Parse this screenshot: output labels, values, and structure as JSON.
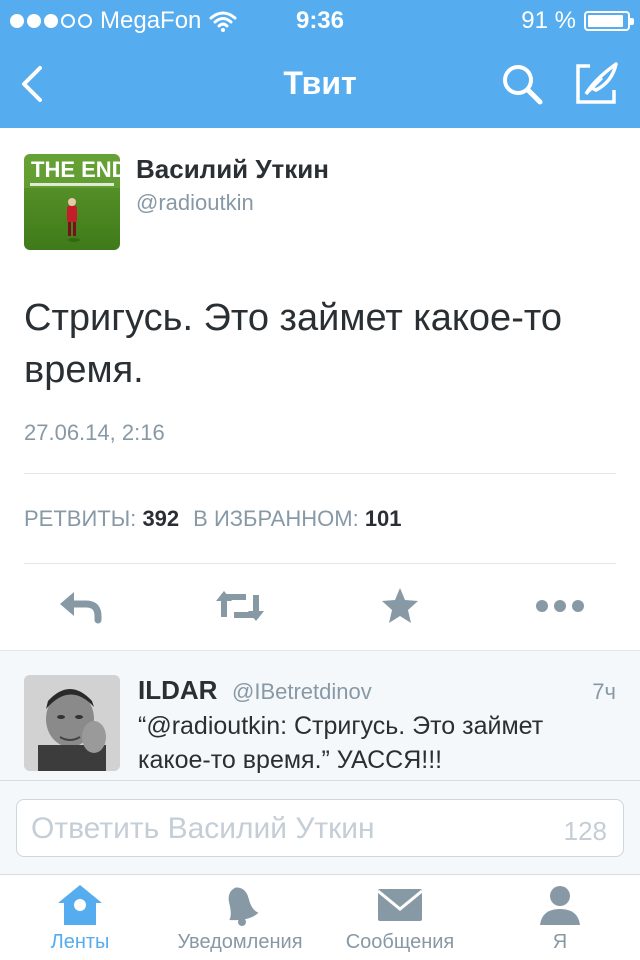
{
  "status_bar": {
    "carrier": "MegaFon",
    "time": "9:36",
    "battery_percent": "91 %",
    "battery_level": 0.91,
    "signal_bars_filled": 3,
    "signal_bars_total": 5
  },
  "nav": {
    "title": "Твит",
    "back_icon": "chevron-left-icon",
    "search_icon": "search-icon",
    "compose_icon": "compose-icon"
  },
  "tweet": {
    "author_name": "Василий Уткин",
    "author_handle": "@radioutkin",
    "avatar_text": "THE END",
    "text": "Стригусь. Это займет какое-то время.",
    "timestamp": "27.06.14, 2:16",
    "retweets_label": "РЕТВИТЫ:",
    "retweets_count": "392",
    "favorites_label": "В ИЗБРАННОМ:",
    "favorites_count": "101"
  },
  "actions": [
    {
      "name": "reply",
      "icon": "reply-icon"
    },
    {
      "name": "retweet",
      "icon": "retweet-icon"
    },
    {
      "name": "favorite",
      "icon": "star-icon"
    },
    {
      "name": "more",
      "icon": "more-icon"
    }
  ],
  "reply": {
    "name": "ILDAR",
    "handle": "@IBetretdinov",
    "time": "7ч",
    "text": "“@radioutkin: Стригусь. Это займет какое-то время.” УАССЯ!!!"
  },
  "compose": {
    "placeholder": "Ответить Василий Уткин",
    "char_count": "128"
  },
  "tabs": [
    {
      "label": "Ленты",
      "icon": "home-icon",
      "active": true
    },
    {
      "label": "Уведомления",
      "icon": "bell-icon",
      "active": false
    },
    {
      "label": "Сообщения",
      "icon": "envelope-icon",
      "active": false
    },
    {
      "label": "Я",
      "icon": "person-icon",
      "active": false
    }
  ],
  "colors": {
    "brand": "#55acee",
    "text": "#292f33",
    "muted": "#8899a6",
    "action_icon": "#8899a6"
  }
}
